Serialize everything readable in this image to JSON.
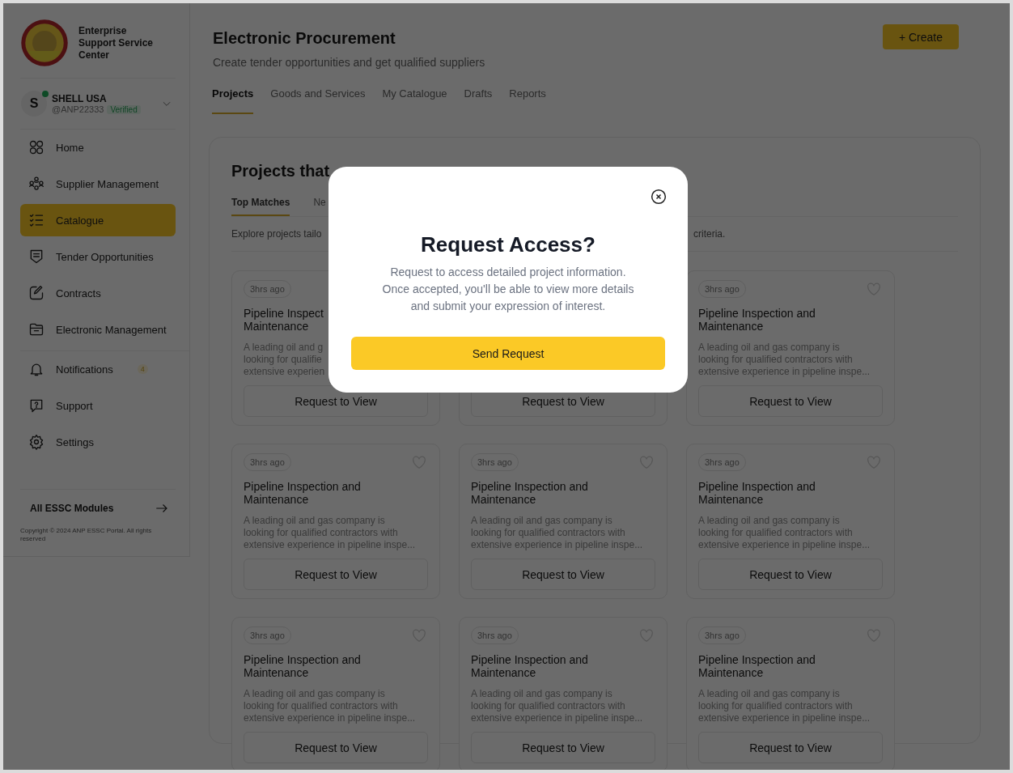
{
  "sidebar": {
    "brand": "Enterprise\nSupport Service\nCenter",
    "account": {
      "initial": "S",
      "name": "SHELL USA",
      "handle": "@ANP22333",
      "badge": "Verified",
      "online": true
    },
    "nav_main": [
      {
        "label": "Home",
        "selected": false
      },
      {
        "label": "Supplier Management",
        "selected": false
      },
      {
        "label": "Catalogue",
        "selected": true
      },
      {
        "label": "Tender Opportunities",
        "selected": false
      },
      {
        "label": "Contracts",
        "selected": false
      },
      {
        "label": "Electronic Management",
        "selected": false
      }
    ],
    "nav_secondary": [
      {
        "label": "Notifications",
        "selected": false,
        "count": "4"
      },
      {
        "label": "Support",
        "selected": false
      },
      {
        "label": "Settings",
        "selected": false
      }
    ],
    "modules_link": "All ESSC Modules",
    "copyright": "Copyright © 2024 ANP ESSC Portal. All rights reserved"
  },
  "header": {
    "title": "Electronic Procurement",
    "subtitle": "Create tender opportunities and get qualified suppliers",
    "create_button": "+ Create",
    "tabs": [
      {
        "label": "Projects",
        "selected": true
      },
      {
        "label": "Goods and Services",
        "selected": false
      },
      {
        "label": "My Catalogue",
        "selected": false
      },
      {
        "label": "Drafts",
        "selected": false
      },
      {
        "label": "Reports",
        "selected": false
      }
    ]
  },
  "panel": {
    "heading": "Projects that",
    "tabs": [
      {
        "label": "Top Matches",
        "selected": true
      },
      {
        "label": "Ne",
        "selected": false
      }
    ],
    "intro_left": "Explore projects tailo",
    "intro_right": "criteria.",
    "cards": [
      {
        "time": "3hrs ago",
        "title": "Pipeline Inspect\nMaintenance",
        "description": "A leading oil and g\nlooking for qualifie\nextensive experien",
        "button": "Request to View"
      },
      {
        "button": "Request to View"
      },
      {
        "time": "3hrs ago",
        "favorite": false,
        "title": "Pipeline Inspection and\nMaintenance",
        "description": "A leading oil and gas company is\nlooking for qualified contractors with\nextensive experience in pipeline inspe...",
        "button": "Request to View"
      },
      {
        "time": "3hrs ago",
        "favorite": false,
        "title": "Pipeline Inspection and\nMaintenance",
        "description": "A leading oil and gas company is\nlooking for qualified contractors with\nextensive experience in pipeline inspe...",
        "button": "Request to View"
      },
      {
        "time": "3hrs ago",
        "favorite": false,
        "title": "Pipeline Inspection and\nMaintenance",
        "description": "A leading oil and gas company is\nlooking for qualified contractors with\nextensive experience in pipeline inspe...",
        "button": "Request to View"
      },
      {
        "time": "3hrs ago",
        "favorite": false,
        "title": "Pipeline Inspection and\nMaintenance",
        "description": "A leading oil and gas company is\nlooking for qualified contractors with\nextensive experience in pipeline inspe...",
        "button": "Request to View"
      },
      {
        "time": "3hrs ago",
        "favorite": false,
        "title": "Pipeline Inspection and\nMaintenance",
        "description": "A leading oil and gas company is\nlooking for qualified contractors with\nextensive experience in pipeline inspe...",
        "button": "Request to View"
      },
      {
        "time": "3hrs ago",
        "favorite": false,
        "title": "Pipeline Inspection and\nMaintenance",
        "description": "A leading oil and gas company is\nlooking for qualified contractors with\nextensive experience in pipeline inspe...",
        "button": "Request to View"
      },
      {
        "time": "3hrs ago",
        "favorite": false,
        "title": "Pipeline Inspection and\nMaintenance",
        "description": "A leading oil and gas company is\nlooking for qualified contractors with\nextensive experience in pipeline inspe...",
        "button": "Request to View"
      }
    ]
  },
  "modal": {
    "title": "Request Access?",
    "body": "Request to access detailed project information.\nOnce accepted, you'll be able to view more details\nand submit your expression of interest.",
    "button": "Send Request"
  }
}
